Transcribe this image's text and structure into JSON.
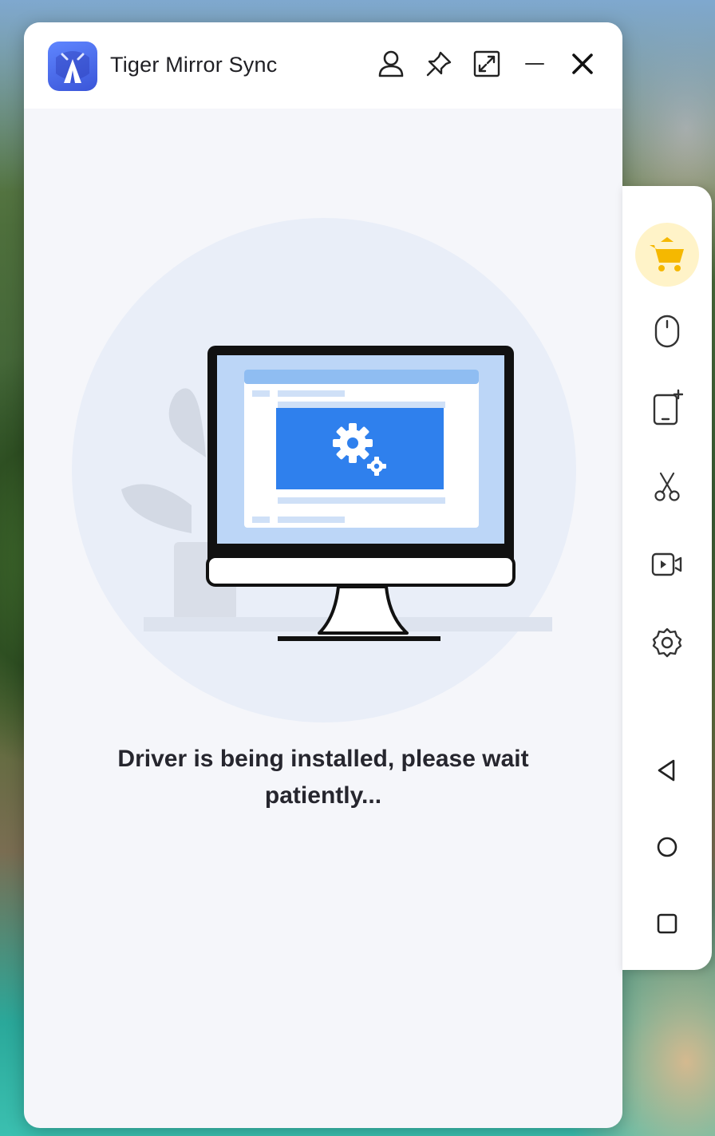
{
  "window": {
    "title": "Tiger Mirror Sync",
    "icons": [
      "account-icon",
      "pin-icon",
      "fullscreen-icon",
      "minimize-icon",
      "close-icon"
    ]
  },
  "main": {
    "status_line1": "Driver is being installed, please wait",
    "status_line2": "patiently..."
  },
  "sidebar": {
    "icons": [
      "shop-cart-icon",
      "mouse-icon",
      "add-device-icon",
      "scissors-icon",
      "screen-record-icon",
      "settings-icon",
      "back-nav-icon",
      "home-nav-icon",
      "recents-nav-icon"
    ]
  },
  "colors": {
    "accent": "#2f80ed",
    "logo": "#4a6cf0",
    "cart": "#f5b800",
    "cart_bg": "#fff3c8",
    "window_bg": "#f5f6fa"
  }
}
